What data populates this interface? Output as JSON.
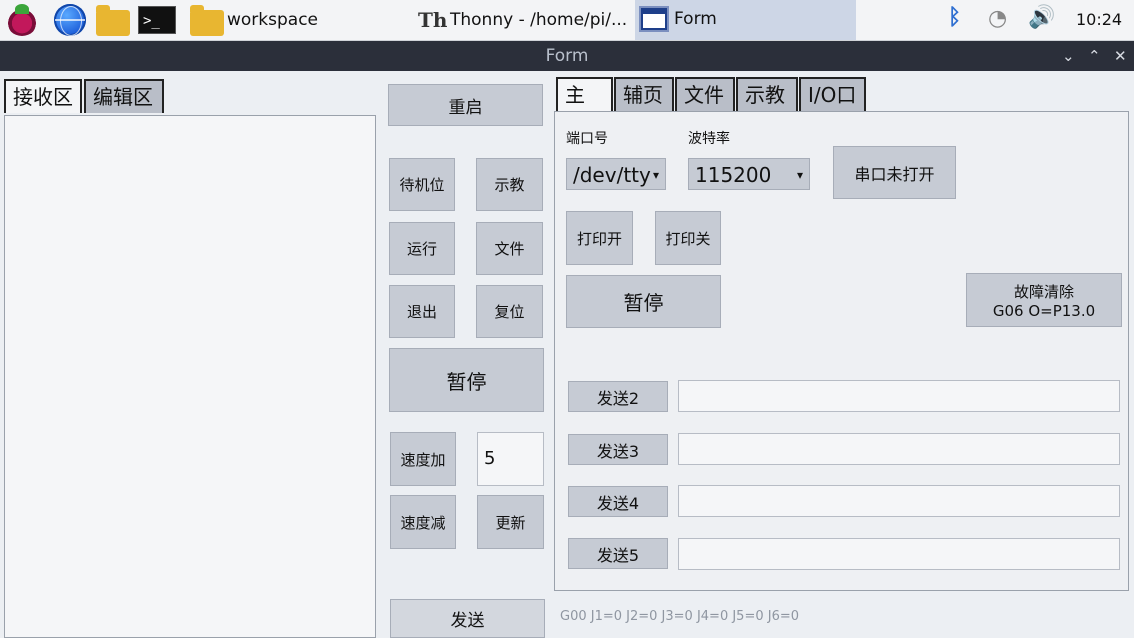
{
  "taskbar": {
    "folder_label": "workspace",
    "thonny_title": "Thonny - /home/pi/...",
    "form_task_title": "Form",
    "clock": "10:24"
  },
  "window": {
    "title": "Form"
  },
  "left_tabs": [
    {
      "label": "接收区"
    },
    {
      "label": "编辑区"
    }
  ],
  "middle": {
    "restart": "重启",
    "standby": "待机位",
    "teach": "示教",
    "run": "运行",
    "file": "文件",
    "exit": "退出",
    "reset": "复位",
    "pause": "暂停",
    "speed_up": "速度加",
    "speed_value": "5",
    "speed_down": "速度减",
    "update": "更新",
    "send": "发送"
  },
  "right_tabs": [
    {
      "label": "主页"
    },
    {
      "label": "辅页"
    },
    {
      "label": "文件"
    },
    {
      "label": "示教"
    },
    {
      "label": "I/O口"
    }
  ],
  "main": {
    "port_label": "端口号",
    "port_value": "/dev/tty",
    "baud_label": "波特率",
    "baud_value": "115200",
    "serial_status": "串口未打开",
    "print_on": "打印开",
    "print_off": "打印关",
    "pause": "暂停",
    "fault_clear": "故障清除",
    "fault_code": "G06 O=P13.0",
    "send2": "发送2",
    "send3": "发送3",
    "send4": "发送4",
    "send5": "发送5"
  },
  "status_line": "G00 J1=0 J2=0 J3=0 J4=0 J5=0 J6=0"
}
